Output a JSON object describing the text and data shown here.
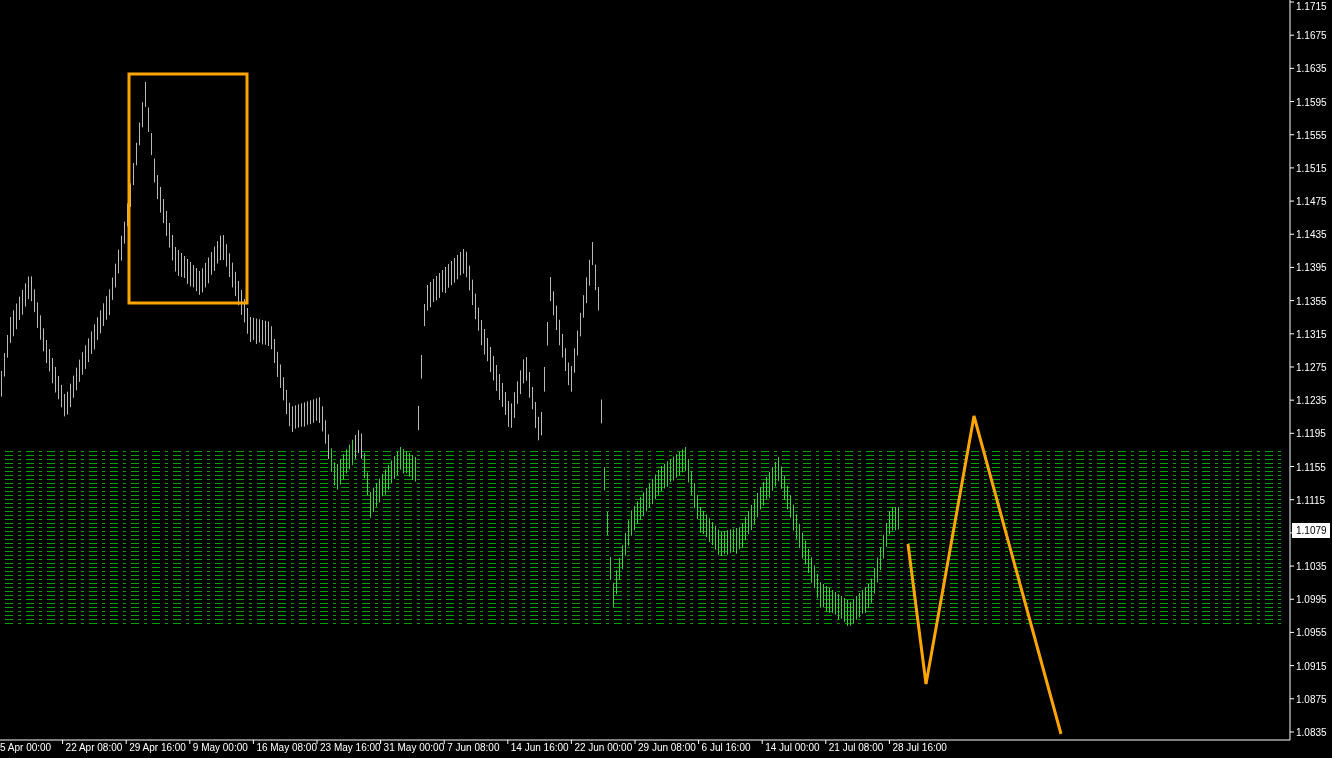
{
  "chart": {
    "y_axis_labels_upper": [
      "1.1715",
      "1.1675",
      "1.1635",
      "1.1595",
      "1.1555",
      "1.1515",
      "1.1475",
      "1.1435",
      "1.1395",
      "1.1355",
      "1.1315",
      "1.1275",
      "1.1235",
      "1.1195",
      "1.1155",
      "1.1115"
    ],
    "y_axis_labels_lower": [
      "1.1035",
      "1.0995",
      "1.0955",
      "1.0915",
      "1.0875",
      "1.0835"
    ],
    "x_axis_labels": [
      "5 Apr 00:00",
      "22 Apr 08:00",
      "29 Apr 16:00",
      "9 May 00:00",
      "16 May 08:00",
      "23 May 16:00",
      "31 May 00:00",
      "7 Jun 08:00",
      "14 Jun 16:00",
      "22 Jun 00:00",
      "29 Jun 08:00",
      "6 Jul 16:00",
      "14 Jul 00:00",
      "21 Jul 08:00",
      "28 Jul 16:00"
    ],
    "current_price": "1.1079"
  }
}
